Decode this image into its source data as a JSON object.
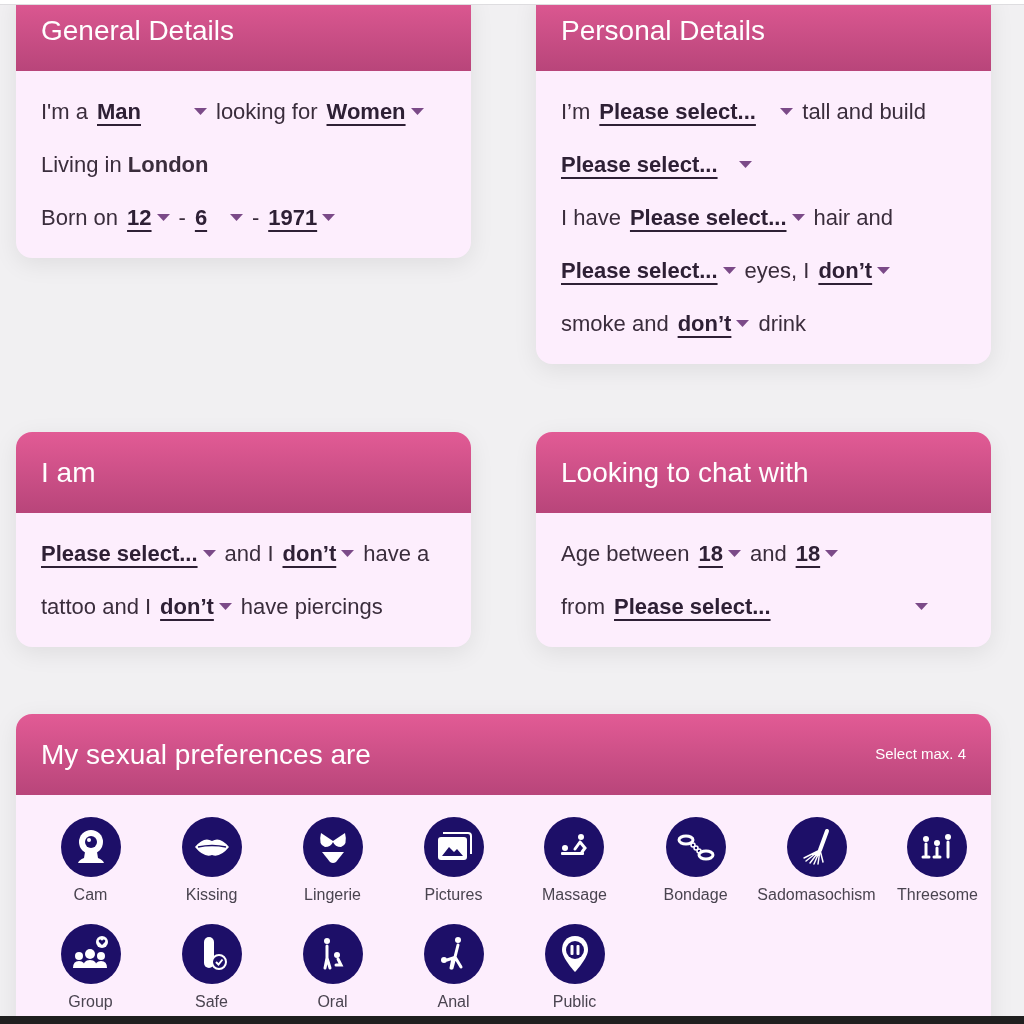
{
  "cards": [
    {
      "title": "General Details",
      "lines": [
        [
          {
            "kind": "text",
            "text": "I'm a"
          },
          {
            "kind": "select",
            "value": "Man"
          },
          {
            "kind": "text",
            "text": "looking for"
          },
          {
            "kind": "select",
            "value": "Women"
          }
        ],
        [
          {
            "kind": "text",
            "text": "Living in **London**"
          }
        ],
        [
          {
            "kind": "text",
            "text": "Born on"
          },
          {
            "kind": "select",
            "value": "12"
          },
          {
            "kind": "text",
            "text": "-"
          },
          {
            "kind": "select",
            "value": "6"
          },
          {
            "kind": "text",
            "text": "-"
          },
          {
            "kind": "select",
            "value": "1971"
          }
        ]
      ]
    },
    {
      "title": "Personal Details",
      "lines": [
        [
          {
            "kind": "text",
            "text": "I’m"
          },
          {
            "kind": "select",
            "value": "Please select..."
          },
          {
            "kind": "text",
            "text": "tall and build"
          }
        ],
        [
          {
            "kind": "select",
            "value": "Please select..."
          }
        ],
        [
          {
            "kind": "text",
            "text": "I have"
          },
          {
            "kind": "select",
            "value": "Please select..."
          },
          {
            "kind": "text",
            "text": "hair and"
          }
        ],
        [
          {
            "kind": "select",
            "value": "Please select..."
          },
          {
            "kind": "text",
            "text": "eyes, I"
          },
          {
            "kind": "select",
            "value": "don’t"
          }
        ],
        [
          {
            "kind": "text",
            "text": "smoke and"
          },
          {
            "kind": "select",
            "value": "don’t"
          },
          {
            "kind": "text",
            "text": "drink"
          }
        ]
      ]
    },
    {
      "title": "I am",
      "lines": [
        [
          {
            "kind": "select",
            "value": "Please select..."
          },
          {
            "kind": "text",
            "text": "and I"
          },
          {
            "kind": "select",
            "value": "don’t"
          },
          {
            "kind": "text",
            "text": "have a"
          }
        ],
        [
          {
            "kind": "text",
            "text": "tattoo and I"
          },
          {
            "kind": "select",
            "value": "don’t"
          },
          {
            "kind": "text",
            "text": "have piercings"
          }
        ]
      ]
    },
    {
      "title": "Looking to chat with",
      "lines": [
        [
          {
            "kind": "text",
            "text": "Age between"
          },
          {
            "kind": "select",
            "value": "18"
          },
          {
            "kind": "text",
            "text": "and"
          },
          {
            "kind": "select",
            "value": "18"
          }
        ],
        [
          {
            "kind": "text",
            "text": "from"
          },
          {
            "kind": "select",
            "value": "Please select..."
          }
        ]
      ]
    }
  ],
  "preferences": {
    "title": "My sexual preferences are",
    "note": "Select max. 4",
    "options": [
      {
        "kind": "cam",
        "label": "Cam"
      },
      {
        "kind": "kissing",
        "label": "Kissing"
      },
      {
        "kind": "lingerie",
        "label": "Lingerie"
      },
      {
        "kind": "pictures",
        "label": "Pictures"
      },
      {
        "kind": "massage",
        "label": "Massage"
      },
      {
        "kind": "bondage",
        "label": "Bondage"
      },
      {
        "kind": "sadomasochism",
        "label": "Sadomasochism"
      },
      {
        "kind": "threesome",
        "label": "Threesome"
      },
      {
        "kind": "group",
        "label": "Group"
      },
      {
        "kind": "safe",
        "label": "Safe"
      },
      {
        "kind": "oral",
        "label": "Oral"
      },
      {
        "kind": "anal",
        "label": "Anal"
      },
      {
        "kind": "public",
        "label": "Public"
      }
    ]
  }
}
